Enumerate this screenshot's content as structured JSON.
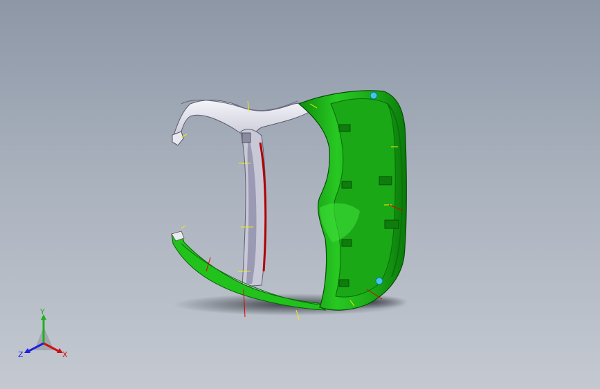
{
  "viewport": {
    "background_top": "#8d97a6",
    "background_bottom": "#c4c9d1"
  },
  "model": {
    "colors": {
      "green_part": "#22c21c",
      "green_shade": "#129c10",
      "white_part": "#e2e2ea",
      "gray_shade": "#8e8ea6",
      "red_edge": "#b00000",
      "cyan_feature": "#3ec8e8",
      "yellow_mark": "#f0f000",
      "red_mark": "#e00000"
    }
  },
  "triad": {
    "labels": {
      "x": "X",
      "y": "Y",
      "z": "Z"
    },
    "colors": {
      "x": "#d01010",
      "y": "#20b020",
      "z": "#2020e0"
    }
  }
}
